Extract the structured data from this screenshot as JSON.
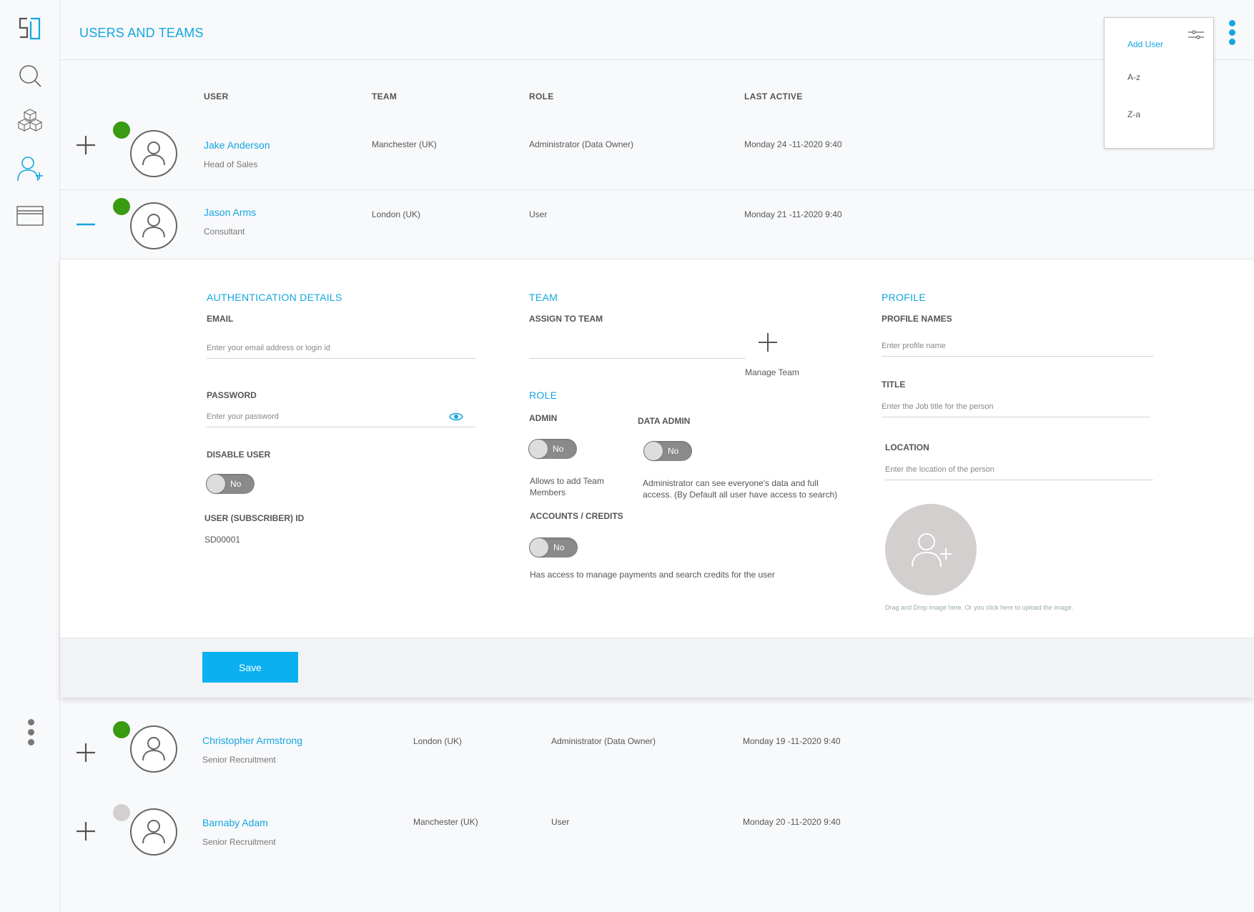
{
  "header": {
    "title": "USERS AND TEAMS"
  },
  "sidebar": {
    "logo": "SD",
    "items": [
      {
        "icon": "search-icon"
      },
      {
        "icon": "cubes-icon"
      },
      {
        "icon": "add-user-icon",
        "active": true
      },
      {
        "icon": "card-icon"
      }
    ]
  },
  "columns": {
    "user": "USER",
    "team": "TEAM",
    "role": "ROLE",
    "last_active": "LAST ACTIVE"
  },
  "users": [
    {
      "name": "Jake Anderson",
      "title": "Head of Sales",
      "team": "Manchester (UK)",
      "role": "Administrator (Data Owner)",
      "last_active": "Monday 24 -11-2020 9:40",
      "online": true
    },
    {
      "name": "Jason Arms",
      "title": "Consultant",
      "team": "London (UK)",
      "role": "User",
      "last_active": "Monday 21 -11-2020 9:40",
      "online": true
    },
    {
      "name": "Christopher Armstrong",
      "title": "Senior Recruitment",
      "team": "London (UK)",
      "role": "Administrator (Data Owner)",
      "last_active": "Monday 19 -11-2020 9:40",
      "online": true
    },
    {
      "name": "Barnaby Adam",
      "title": "Senior Recruitment",
      "team": "Manchester (UK)",
      "role": "User",
      "last_active": "Monday 20 -11-2020 9:40",
      "online": false
    }
  ],
  "detail": {
    "auth": {
      "title": "AUTHENTICATION  DETAILS",
      "email_label": "EMAIL",
      "email_placeholder": "Enter your email address or login id",
      "password_label": "PASSWORD",
      "password_placeholder": "Enter your password",
      "disable_label": "DISABLE USER",
      "disable_value": "No",
      "id_label": "USER (SUBSCRIBER) ID",
      "id_value": "SD00001"
    },
    "team": {
      "title": "TEAM",
      "assign_label": "ASSIGN TO TEAM",
      "manage_label": "Manage Team",
      "role_title": "ROLE",
      "admin_label": "ADMIN",
      "admin_value": "No",
      "admin_desc": "Allows to add Team Members",
      "data_admin_label": "DATA ADMIN",
      "data_admin_value": "No",
      "data_admin_desc": "Administrator can see everyone's data and full access. (By Default all user have access to search)",
      "accounts_label": "ACCOUNTS / CREDITS",
      "accounts_value": "No",
      "accounts_desc": "Has access to manage payments and search credits for the user"
    },
    "profile": {
      "title": "PROFILE",
      "names_label": "PROFILE  NAMES",
      "names_placeholder": "Enter profile name",
      "title_label": "TITLE",
      "title_placeholder": "Enter the Job title for the person",
      "location_label": "LOCATION",
      "location_placeholder": "Enter the location of the person",
      "upload_hint": "Drag and Drop image here. Or you click here to upload the image."
    },
    "save_label": "Save"
  },
  "menu": {
    "items": [
      "Add User",
      "A-z",
      "Z-a"
    ]
  },
  "colors": {
    "accent": "#13a6e0",
    "online": "#3a9a12",
    "offline": "#d3cfcf",
    "save": "#0bb0f0"
  }
}
